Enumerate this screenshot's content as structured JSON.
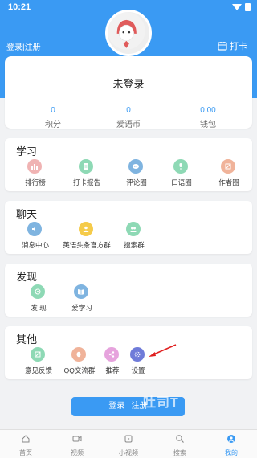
{
  "status_bar": {
    "time": "10:21"
  },
  "header": {
    "login_link": "登录|注册",
    "checkin_label": "打卡"
  },
  "profile": {
    "name": "未登录",
    "stats": [
      {
        "value": "0",
        "label": "积分"
      },
      {
        "value": "0",
        "label": "爱语币"
      },
      {
        "value": "0.00",
        "label": "钱包"
      }
    ]
  },
  "sections": [
    {
      "title": "学习",
      "items": [
        {
          "label": "排行榜",
          "icon": "ranking-icon",
          "color": "#f0b3b3"
        },
        {
          "label": "打卡报告",
          "icon": "checkin-report-icon",
          "color": "#8ed9b5"
        },
        {
          "label": "评论圈",
          "icon": "comment-icon",
          "color": "#7fb4e0"
        },
        {
          "label": "口语圈",
          "icon": "microphone-icon",
          "color": "#8ed9b5"
        },
        {
          "label": "作者圈",
          "icon": "author-icon",
          "color": "#f0b39a"
        }
      ]
    },
    {
      "title": "聊天",
      "items": [
        {
          "label": "消息中心",
          "icon": "speaker-icon",
          "color": "#7fb4e0"
        },
        {
          "label": "英语头条官方群",
          "icon": "group-icon",
          "color": "#f5cb4a"
        },
        {
          "label": "搜索群",
          "icon": "search-group-icon",
          "color": "#8ed9b5"
        }
      ]
    },
    {
      "title": "发现",
      "items": [
        {
          "label": "发 现",
          "icon": "discover-icon",
          "color": "#8ed9b5"
        },
        {
          "label": "爱学习",
          "icon": "study-icon",
          "color": "#7fb4e0"
        }
      ]
    },
    {
      "title": "其他",
      "items": [
        {
          "label": "意见反馈",
          "icon": "feedback-icon",
          "color": "#8ed9b5"
        },
        {
          "label": "QQ交流群",
          "icon": "qq-icon",
          "color": "#f0b39a"
        },
        {
          "label": "推荐",
          "icon": "share-icon",
          "color": "#e6a3dd"
        },
        {
          "label": "设置",
          "icon": "settings-icon",
          "color": "#6f7bd9"
        }
      ]
    }
  ],
  "cta": {
    "label": "登录 | 注册"
  },
  "watermark": "吐司T",
  "tabs": [
    {
      "label": "首页",
      "icon": "home-icon"
    },
    {
      "label": "视频",
      "icon": "video-icon"
    },
    {
      "label": "小视频",
      "icon": "short-video-icon"
    },
    {
      "label": "搜索",
      "icon": "search-icon"
    },
    {
      "label": "我的",
      "icon": "profile-icon",
      "active": true
    }
  ]
}
